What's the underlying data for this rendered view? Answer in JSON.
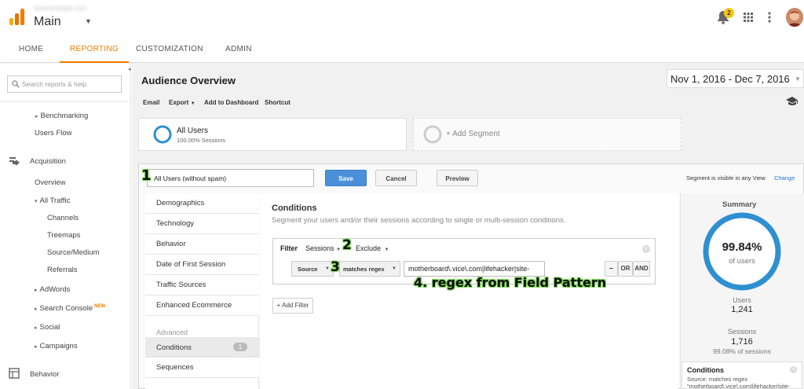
{
  "topbar": {
    "account_blurred": "www.example.com",
    "property": "Main",
    "notifications_count": "2"
  },
  "nav": {
    "tabs": [
      "HOME",
      "REPORTING",
      "CUSTOMIZATION",
      "ADMIN"
    ]
  },
  "sidebar": {
    "search_placeholder": "Search reports & help",
    "benchmarking": "Benchmarking",
    "users_flow": "Users Flow",
    "acquisition": "Acquisition",
    "overview": "Overview",
    "all_traffic": "All Traffic",
    "channels": "Channels",
    "treemaps": "Treemaps",
    "source_medium": "Source/Medium",
    "referrals": "Referrals",
    "adwords": "AdWords",
    "search_console": "Search Console",
    "new_badge": "NEW",
    "social": "Social",
    "campaigns": "Campaigns",
    "behavior": "Behavior"
  },
  "header": {
    "title": "Audience Overview",
    "date_range": "Nov 1, 2016 - Dec 7, 2016",
    "toolbar": {
      "email": "Email",
      "export": "Export",
      "add_to_dashboard": "Add to Dashboard",
      "shortcut": "Shortcut"
    }
  },
  "segments": {
    "all_users": "All Users",
    "all_users_sub": "100.00% Sessions",
    "add_segment": "+ Add Segment"
  },
  "editor": {
    "segment_name": "All Users (without spam)",
    "save": "Save",
    "cancel": "Cancel",
    "preview": "Preview",
    "visible_text": "Segment is visible in any View",
    "change": "Change",
    "left_menu": [
      "Demographics",
      "Technology",
      "Behavior",
      "Date of First Session",
      "Traffic Sources",
      "Enhanced Ecommerce"
    ],
    "advanced_label": "Advanced",
    "conditions_item": "Conditions",
    "conditions_count": "1",
    "sequences_item": "Sequences",
    "conditions_title": "Conditions",
    "conditions_desc": "Segment your users and/or their sessions according to single or multi-session conditions.",
    "filter_label": "Filter",
    "filter_scope": "Sessions",
    "filter_mode": "Exclude",
    "dimension": "Source",
    "operator": "matches regex",
    "regex_value": "motherboard\\.vice\\.com|lifehacker|site-",
    "minus": "–",
    "or": "OR",
    "and": "AND",
    "add_filter": "+ Add Filter"
  },
  "summary": {
    "title": "Summary",
    "percent": "99.84%",
    "percent_label": "of users",
    "users_label": "Users",
    "users_value": "1,241",
    "sessions_label": "Sessions",
    "sessions_value": "1,716",
    "sessions_pct": "99.08% of sessions",
    "conditions_title": "Conditions",
    "conditions_line1": "Source: matches regex",
    "conditions_line2": "\"motherboard\\.vice\\.com|lifehacker|site-"
  },
  "annotations": {
    "a1": "1",
    "a2": "2",
    "a3": "3",
    "a4": "4. regex from Field Pattern"
  },
  "colors": {
    "accent_orange": "#f57c00",
    "ga_blue": "#4a90d9",
    "ring_blue": "#2e8fd1",
    "annotation_green": "#7ed957"
  }
}
